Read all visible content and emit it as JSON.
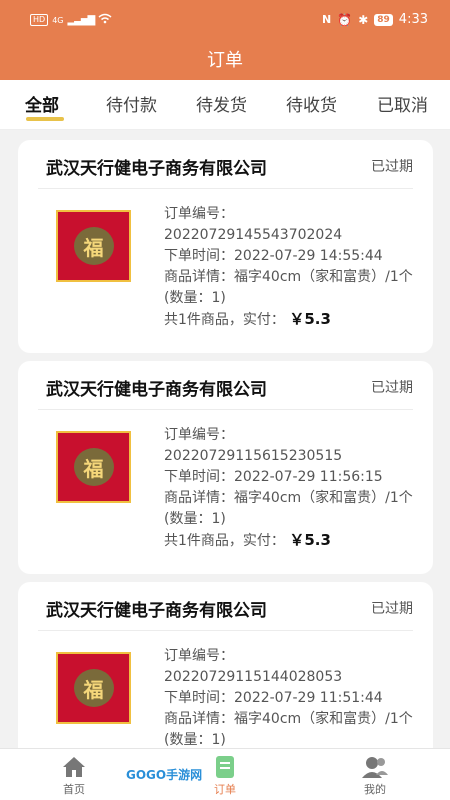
{
  "statusbar": {
    "left_chip": "HD",
    "signal": "4G",
    "battery": "89",
    "time": "4:33"
  },
  "header": {
    "title": "订单"
  },
  "tabs": [
    {
      "label": "全部",
      "active": true
    },
    {
      "label": "待付款",
      "active": false
    },
    {
      "label": "待发货",
      "active": false
    },
    {
      "label": "待收货",
      "active": false
    },
    {
      "label": "已取消",
      "active": false
    }
  ],
  "orders": [
    {
      "shop": "武汉天行健电子商务有限公司",
      "status": "已过期",
      "order_no_label": "订单编号：",
      "order_no": "20220729145543702024",
      "time_label": "下单时间：",
      "time": "2022-07-29 14:55:44",
      "detail_label": "商品详情：",
      "detail": "福字40cm（家和富贵）/1个(数量：1)",
      "summary": "共1件商品，实付：",
      "price": "￥5.3"
    },
    {
      "shop": "武汉天行健电子商务有限公司",
      "status": "已过期",
      "order_no_label": "订单编号：",
      "order_no": "20220729115615230515",
      "time_label": "下单时间：",
      "time": "2022-07-29 11:56:15",
      "detail_label": "商品详情：",
      "detail": "福字40cm（家和富贵）/1个(数量：1)",
      "summary": "共1件商品，实付：",
      "price": "￥5.3"
    },
    {
      "shop": "武汉天行健电子商务有限公司",
      "status": "已过期",
      "order_no_label": "订单编号：",
      "order_no": "20220729115144028053",
      "time_label": "下单时间：",
      "time": "2022-07-29 11:51:44",
      "detail_label": "商品详情：",
      "detail": "福字40cm（家和富贵）/1个(数量：1)",
      "summary": "",
      "price": ""
    }
  ],
  "bottom_nav": [
    {
      "label": "首页",
      "icon": "home-icon"
    },
    {
      "label": "订单",
      "icon": "order-icon"
    },
    {
      "label": "我的",
      "icon": "user-icon"
    }
  ],
  "watermark": "GOGO手游网",
  "colors": {
    "brand": "#e67e4e",
    "tab_underline": "#e8c24a"
  }
}
